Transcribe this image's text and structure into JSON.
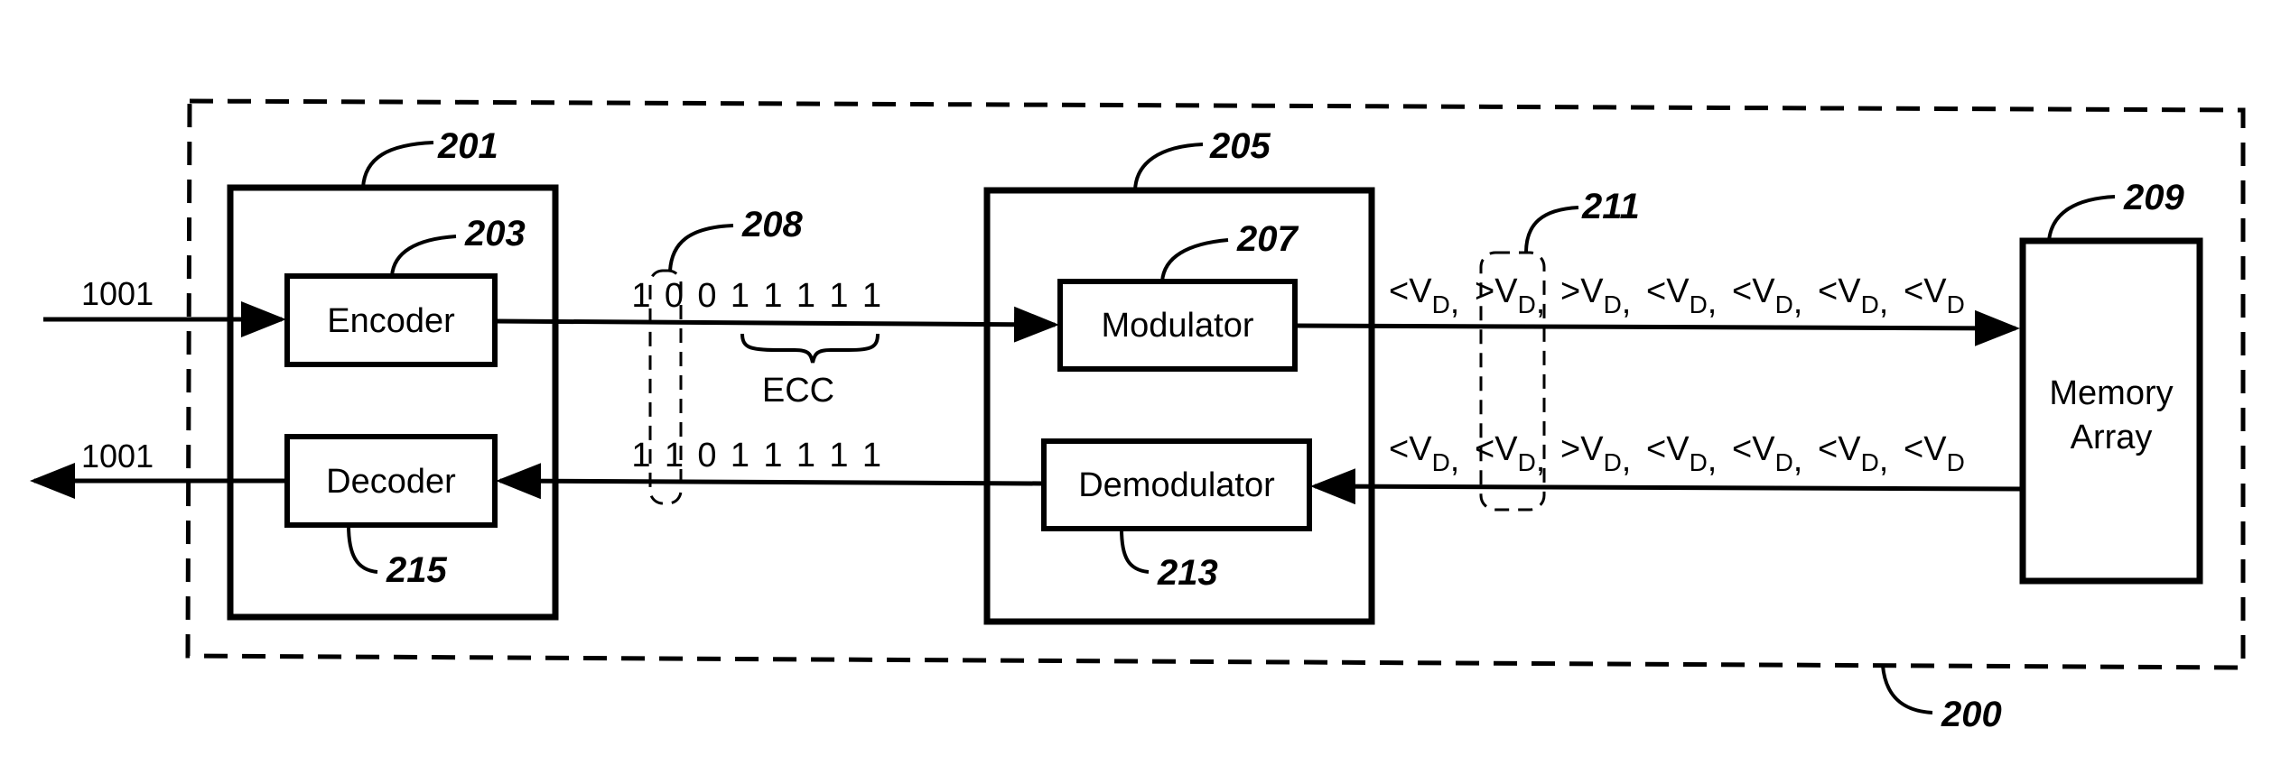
{
  "figure": {
    "system_ref": "200",
    "input_data": "1001",
    "output_data": "1001"
  },
  "blocks": {
    "codec": {
      "ref": "201"
    },
    "encoder": {
      "label": "Encoder",
      "ref": "203"
    },
    "decoder": {
      "label": "Decoder",
      "ref": "215"
    },
    "modem": {
      "ref": "205"
    },
    "modulator": {
      "label": "Modulator",
      "ref": "207"
    },
    "demodulator": {
      "label": "Demodulator",
      "ref": "213"
    },
    "memory_array": {
      "label_line1": "Memory",
      "label_line2": "Array",
      "ref": "209"
    }
  },
  "codewords": {
    "highlight_ref": "208",
    "written_bits": [
      "1",
      "0",
      "0",
      "1",
      "1",
      "1",
      "1",
      "1"
    ],
    "read_bits": [
      "1",
      "1",
      "0",
      "1",
      "1",
      "1",
      "1",
      "1"
    ],
    "ecc_label": "ECC"
  },
  "levels": {
    "highlight_ref": "211",
    "symbol": "V",
    "subscript": "D",
    "written": [
      "<",
      ">",
      ">",
      "<",
      "<",
      "<",
      "<"
    ],
    "read": [
      "<",
      "<",
      ">",
      "<",
      "<",
      "<",
      "<"
    ]
  }
}
